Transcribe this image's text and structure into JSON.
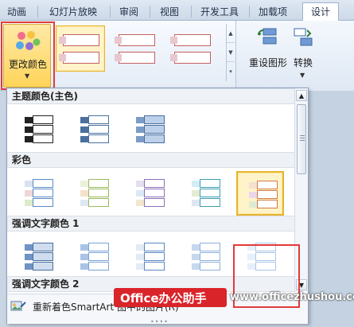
{
  "tabs": [
    {
      "label": "动画",
      "active": false
    },
    {
      "label": "幻灯片放映",
      "active": false
    },
    {
      "label": "审阅",
      "active": false
    },
    {
      "label": "视图",
      "active": false
    },
    {
      "label": "开发工具",
      "active": false
    },
    {
      "label": "加载项",
      "active": false
    },
    {
      "label": "设计",
      "active": true
    }
  ],
  "ribbon": {
    "change_colors_label": "更改颜色",
    "reset_graphic_label": "重设图形",
    "convert_label": "转换"
  },
  "dropdown": {
    "sections": [
      {
        "title": "主题颜色(主色)",
        "style": "theme"
      },
      {
        "title": "彩色",
        "style": "colorful"
      },
      {
        "title": "强调文字颜色 1",
        "style": "accent1"
      },
      {
        "title": "强调文字颜色 2",
        "style": "accent2"
      }
    ],
    "footer_label": "重新着色SmartArt 图中的图片(R)"
  },
  "colors": {
    "ribbon_selected_border": "#e4b52e",
    "highlight_frame": "#e23a3a",
    "accent_blue": "#4b6f9f"
  },
  "watermark": {
    "badge": "Office办公助手",
    "url": "www.officezhushou.com"
  }
}
